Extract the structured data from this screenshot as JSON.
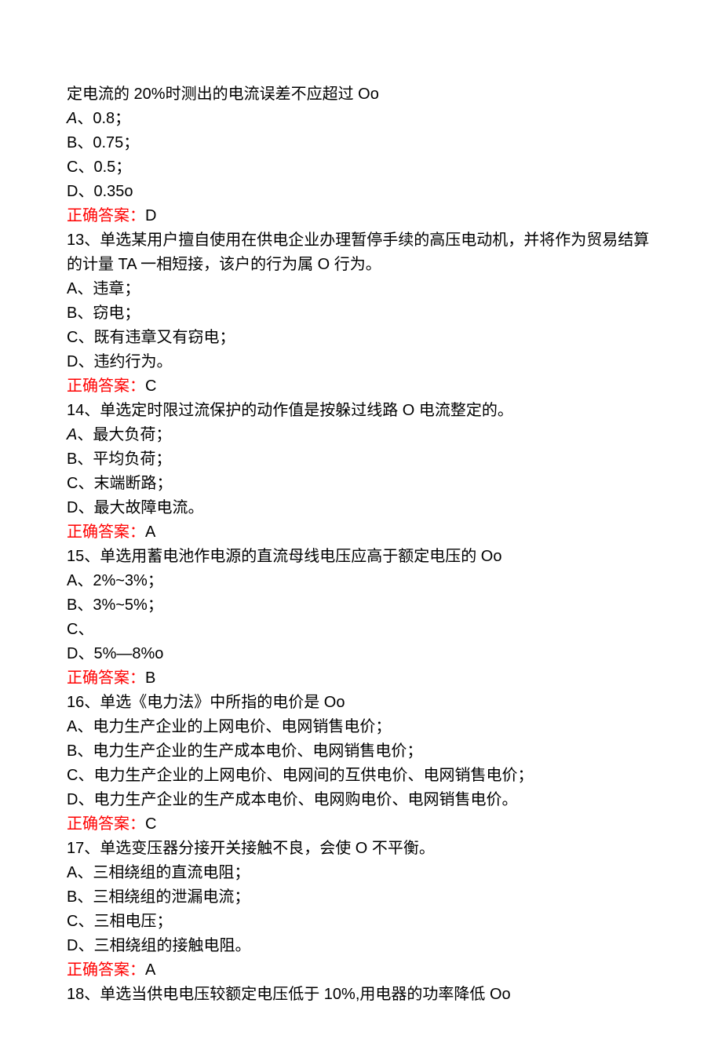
{
  "lines": [
    {
      "text": "定电流的 20%时测出的电流误差不应超过 Oo"
    },
    {
      "prefix_i": "A",
      "text": "、0.8；"
    },
    {
      "text": "B、0.75；"
    },
    {
      "text": "C、0.5；"
    },
    {
      "text": "D、0.35o"
    },
    {
      "answer_label": "正确答案：",
      "answer_value": "D"
    },
    {
      "text": "13、单选某用户擅自使用在供电企业办理暂停手续的高压电动机，并将作为贸易结算的计量 TA 一相短接，该户的行为属 O 行为。"
    },
    {
      "text": "A、违章；"
    },
    {
      "text": "B、窃电；"
    },
    {
      "text": "C、既有违章又有窃电；"
    },
    {
      "text": "D、违约行为。"
    },
    {
      "answer_label": "正确答案：",
      "answer_value": "C"
    },
    {
      "text": "14、单选定时限过流保护的动作值是按躲过线路 O 电流整定的。"
    },
    {
      "prefix_i": "A",
      "text": "、最大负荷；"
    },
    {
      "text": "B、平均负荷；"
    },
    {
      "text": "C、末端断路；"
    },
    {
      "text": "D、最大故障电流。"
    },
    {
      "answer_label": "正确答案：",
      "answer_value": "A"
    },
    {
      "text": "15、单选用蓄电池作电源的直流母线电压应高于额定电压的 Oo"
    },
    {
      "text": "A、2%~3%；"
    },
    {
      "text": "B、3%~5%；"
    },
    {
      "text": "C、"
    },
    {
      "text": "D、5%—8%o"
    },
    {
      "answer_label": "正确答案：",
      "answer_value": "B"
    },
    {
      "text": "16、单选《电力法》中所指的电价是 Oo"
    },
    {
      "text": "A、电力生产企业的上网电价、电网销售电价；"
    },
    {
      "text": "B、电力生产企业的生产成本电价、电网销售电价；"
    },
    {
      "text": "C、电力生产企业的上网电价、电网间的互供电价、电网销售电价；"
    },
    {
      "text": "D、电力生产企业的生产成本电价、电网购电价、电网销售电价。"
    },
    {
      "answer_label": "正确答案：",
      "answer_value": "C"
    },
    {
      "text": "17、单选变压器分接开关接触不良，会使 O 不平衡。"
    },
    {
      "text": "A、三相绕组的直流电阻；"
    },
    {
      "text": "B、三相绕组的泄漏电流；"
    },
    {
      "text": "C、三相电压；"
    },
    {
      "text": "D、三相绕组的接触电阻。"
    },
    {
      "answer_label": "正确答案：",
      "answer_value": "A"
    },
    {
      "text": "18、单选当供电电压较额定电压低于 10%,用电器的功率降低 Oo"
    }
  ]
}
